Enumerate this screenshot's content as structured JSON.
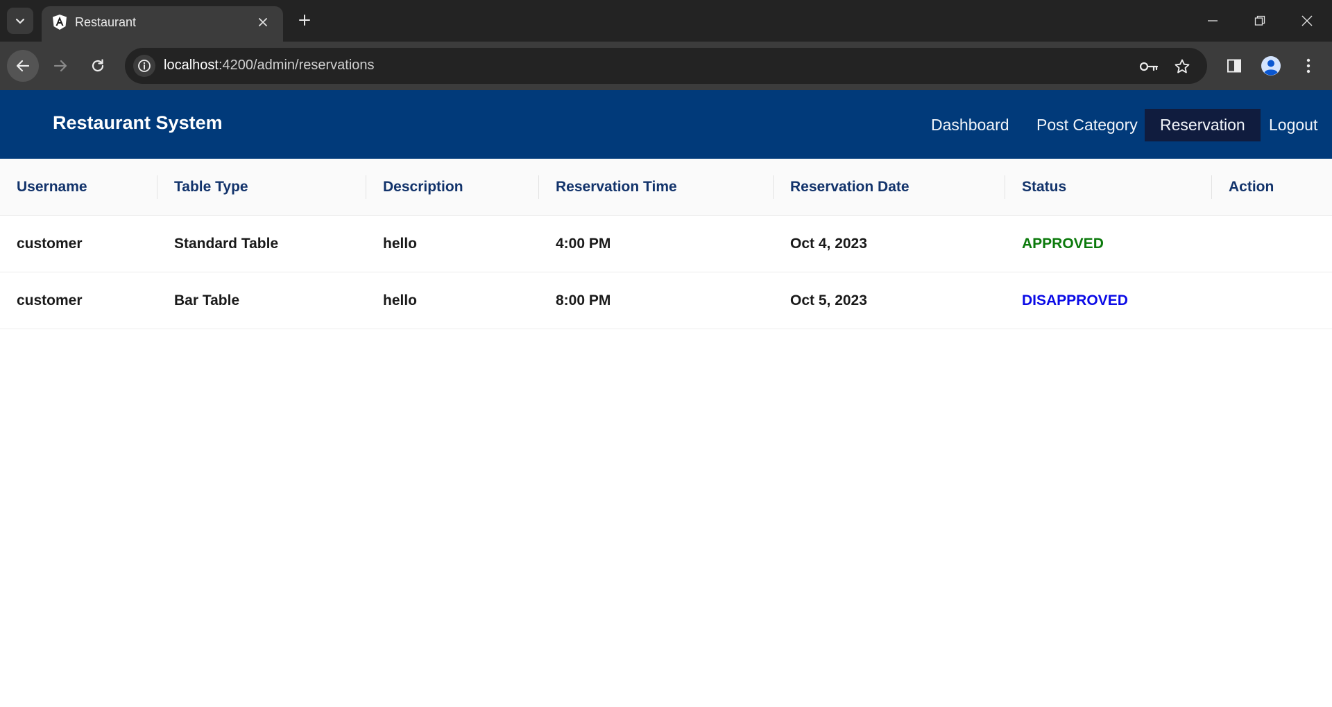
{
  "browser": {
    "tab_title": "Restaurant",
    "url_host": "localhost",
    "url_path": ":4200/admin/reservations",
    "icons": [
      "tab-search-icon",
      "angular-favicon",
      "close-icon",
      "plus-icon",
      "minimize-icon",
      "restore-icon",
      "close-window-icon",
      "back-arrow-icon",
      "forward-arrow-icon",
      "reload-icon",
      "info-icon",
      "key-icon",
      "star-icon",
      "side-panel-icon",
      "profile-icon",
      "kebab-menu-icon"
    ]
  },
  "header": {
    "brand": "Restaurant System",
    "nav": [
      {
        "label": "Dashboard"
      },
      {
        "label": "Post Category"
      },
      {
        "label": "Reservation"
      },
      {
        "label": "Logout"
      }
    ],
    "active_nav": "Reservation",
    "colors": {
      "header_bg": "#013a7a",
      "active_bg": "#101c3e"
    }
  },
  "table": {
    "columns": [
      "Username",
      "Table Type",
      "Description",
      "Reservation Time",
      "Reservation Date",
      "Status",
      "Action"
    ],
    "rows": [
      {
        "username": "customer",
        "table_type": "Standard Table",
        "description": "hello",
        "time": "4:00 PM",
        "date": "Oct 4, 2023",
        "status": "APPROVED",
        "status_color": "#0c7a0c"
      },
      {
        "username": "customer",
        "table_type": "Bar Table",
        "description": "hello",
        "time": "8:00 PM",
        "date": "Oct 5, 2023",
        "status": "DISAPPROVED",
        "status_color": "#0a0ae6"
      }
    ]
  }
}
